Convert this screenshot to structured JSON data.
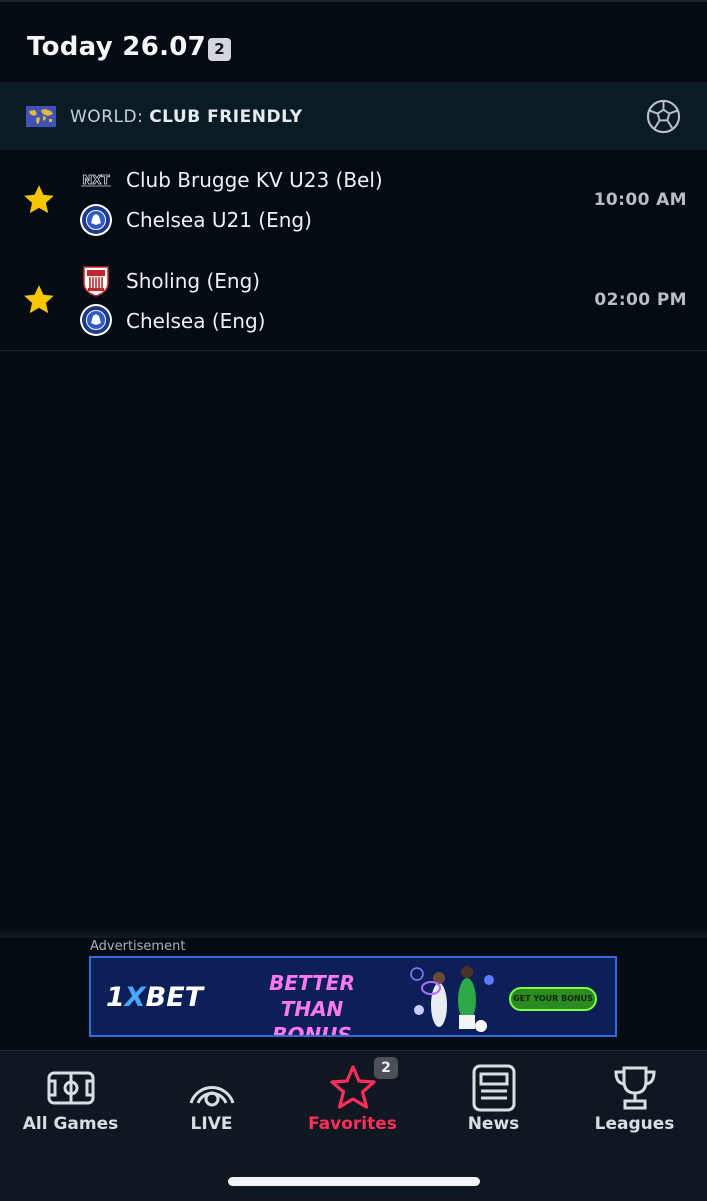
{
  "header": {
    "title": "Today 26.07.",
    "count_badge": "2"
  },
  "league": {
    "prefix": "WORLD: ",
    "name": "CLUB FRIENDLY",
    "flag_icon": "world-flag-icon",
    "sport_icon": "soccer-ball-icon"
  },
  "matches": [
    {
      "home": "Club Brugge KV U23 (Bel)",
      "away": "Chelsea U21 (Eng)",
      "time": "10:00 AM",
      "favorite": true
    },
    {
      "home": "Sholing (Eng)",
      "away": "Chelsea (Eng)",
      "time": "02:00 PM",
      "favorite": true
    }
  ],
  "ad": {
    "label": "Advertisement",
    "brand_prefix": "1",
    "brand_x": "X",
    "brand_suffix": "BET",
    "headline_line1": "BETTER THAN",
    "headline_line2": "BONUS",
    "cta": "GET YOUR BONUS"
  },
  "nav": {
    "items": [
      {
        "label": "All Games",
        "icon": "pitch-icon"
      },
      {
        "label": "LIVE",
        "icon": "live-signal-icon"
      },
      {
        "label": "Favorites",
        "icon": "star-outline-icon",
        "badge": "2"
      },
      {
        "label": "News",
        "icon": "newspaper-icon"
      },
      {
        "label": "Leagues",
        "icon": "trophy-icon"
      }
    ]
  },
  "colors": {
    "accent": "#ff2e5b",
    "favorite_star": "#f7c600",
    "background": "#050b12"
  }
}
